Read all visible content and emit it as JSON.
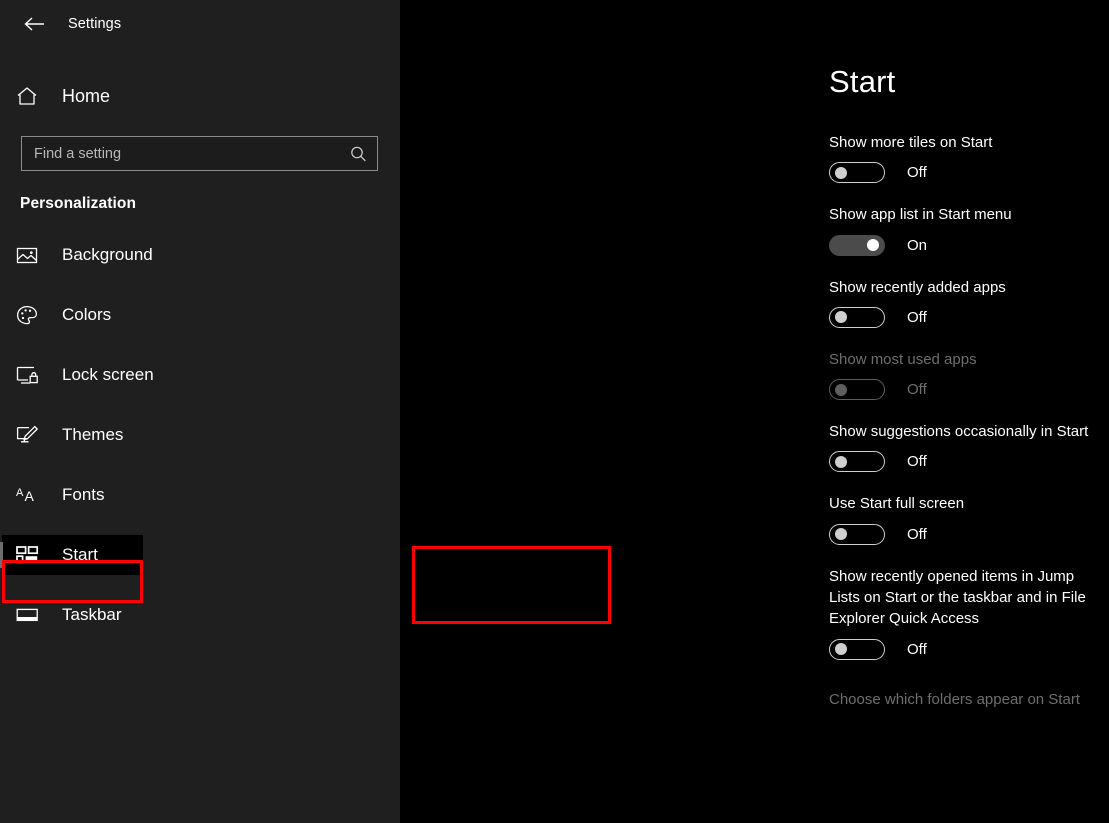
{
  "window": {
    "title": "Settings",
    "back_icon": "back-arrow-icon"
  },
  "sidebar": {
    "home": {
      "label": "Home",
      "icon": "home-icon"
    },
    "search": {
      "value": "",
      "placeholder": "Find a setting",
      "icon": "search-icon"
    },
    "section_header": "Personalization",
    "items": [
      {
        "label": "Background",
        "icon": "image-icon",
        "selected": false
      },
      {
        "label": "Colors",
        "icon": "palette-icon",
        "selected": false
      },
      {
        "label": "Lock screen",
        "icon": "lock-screen-icon",
        "selected": false
      },
      {
        "label": "Themes",
        "icon": "themes-brush-icon",
        "selected": false
      },
      {
        "label": "Fonts",
        "icon": "fonts-aa-icon",
        "selected": false
      },
      {
        "label": "Start",
        "icon": "start-tiles-icon",
        "selected": true
      },
      {
        "label": "Taskbar",
        "icon": "taskbar-icon",
        "selected": false
      }
    ]
  },
  "main": {
    "title": "Start",
    "settings": [
      {
        "label": "Show more tiles on Start",
        "state": "Off",
        "on": false,
        "disabled": false
      },
      {
        "label": "Show app list in Start menu",
        "state": "On",
        "on": true,
        "disabled": false
      },
      {
        "label": "Show recently added apps",
        "state": "Off",
        "on": false,
        "disabled": false
      },
      {
        "label": "Show most used apps",
        "state": "Off",
        "on": false,
        "disabled": true
      },
      {
        "label": "Show suggestions occasionally in Start",
        "state": "Off",
        "on": false,
        "disabled": false
      },
      {
        "label": "Use Start full screen",
        "state": "Off",
        "on": false,
        "disabled": false
      },
      {
        "label": "Show recently opened items in Jump Lists on Start or the taskbar and in File Explorer Quick Access",
        "state": "Off",
        "on": false,
        "disabled": false
      }
    ],
    "folders_link": "Choose which folders appear on Start"
  },
  "annotations": {
    "color": "#ff0000",
    "boxes": [
      {
        "name": "sidebar-start-highlight",
        "target": "Start"
      },
      {
        "name": "use-start-full-screen-highlight",
        "target": "Use Start full screen"
      }
    ]
  }
}
